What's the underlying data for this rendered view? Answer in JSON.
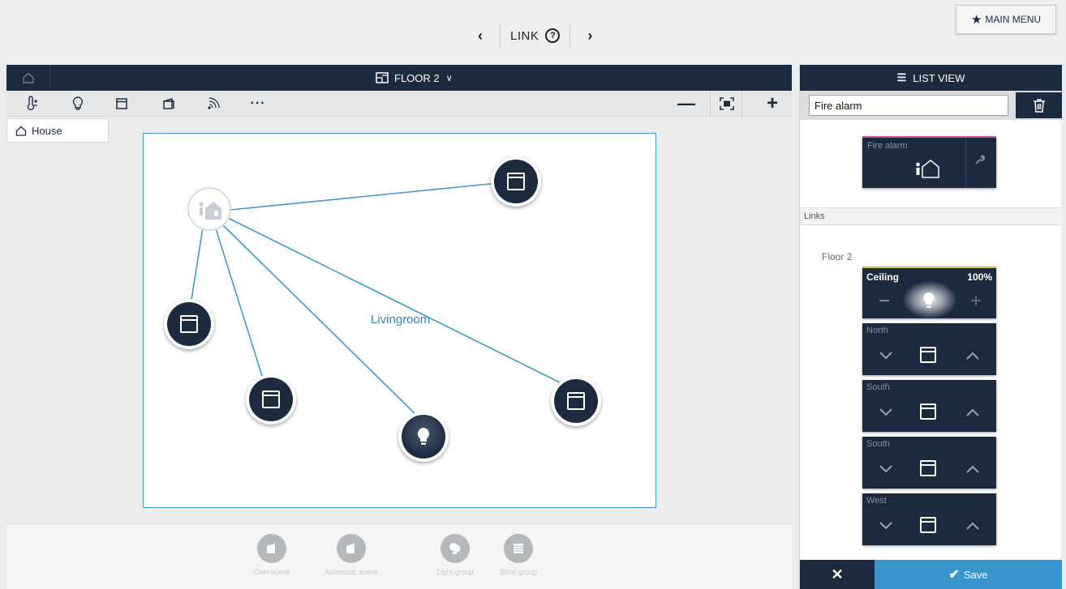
{
  "header": {
    "title": "LINK",
    "prev_label": "‹",
    "next_label": "›",
    "help_label": "?",
    "main_menu_label": "MAIN MENU"
  },
  "floor_bar": {
    "title": "FLOOR 2"
  },
  "toolbar": {
    "more_label": "···",
    "zoom_out_label": "—",
    "zoom_in_label": "+"
  },
  "tree": {
    "house_label": "House"
  },
  "canvas": {
    "room_label": "Livingroom",
    "devices": [
      {
        "type": "blind",
        "name": "blind-device"
      },
      {
        "type": "blind",
        "name": "blind-device"
      },
      {
        "type": "blind",
        "name": "blind-device"
      },
      {
        "type": "blind",
        "name": "blind-device"
      },
      {
        "type": "light",
        "name": "light-device"
      }
    ]
  },
  "scenes": [
    {
      "label": "Own scene",
      "icon": "scene-icon"
    },
    {
      "label": "Automatic scene",
      "icon": "automatic-scene-icon"
    },
    {
      "label": "Light group",
      "icon": "light-group-icon"
    },
    {
      "label": "Blind group",
      "icon": "blind-group-icon"
    }
  ],
  "right_panel": {
    "list_view_label": "LIST VIEW",
    "search_value": "Fire alarm",
    "sensor_card_title": "Fire alarm",
    "links_header": "Links",
    "floor_label": "Floor 2",
    "ceiling": {
      "title": "Ceiling",
      "level": "100%"
    },
    "blind_cards": [
      {
        "title": "North"
      },
      {
        "title": "South"
      },
      {
        "title": "South"
      },
      {
        "title": "West"
      }
    ],
    "cancel_label": "✕",
    "save_label": "Save"
  },
  "colors": {
    "navy": "#1c2a40",
    "accent_blue": "#3a95cf",
    "link_line": "#3d9ad1",
    "fire_alarm_accent": "#c65aa4",
    "ceiling_accent": "#c5c93a"
  }
}
